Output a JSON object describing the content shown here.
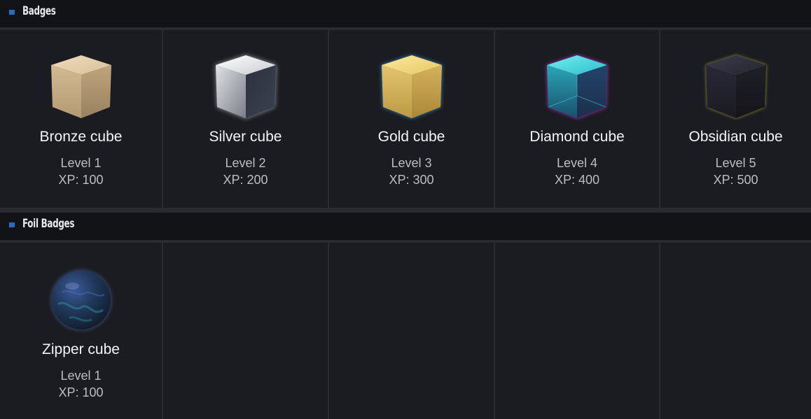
{
  "sections": [
    {
      "title": "Badges",
      "badges": [
        {
          "name": "Bronze cube",
          "level": "Level 1",
          "xp": "XP: 100",
          "icon": "bronze-cube-icon"
        },
        {
          "name": "Silver cube",
          "level": "Level 2",
          "xp": "XP: 200",
          "icon": "silver-cube-icon"
        },
        {
          "name": "Gold cube",
          "level": "Level 3",
          "xp": "XP: 300",
          "icon": "gold-cube-icon"
        },
        {
          "name": "Diamond cube",
          "level": "Level 4",
          "xp": "XP: 400",
          "icon": "diamond-cube-icon"
        },
        {
          "name": "Obsidian cube",
          "level": "Level 5",
          "xp": "XP: 500",
          "icon": "obsidian-cube-icon"
        }
      ]
    },
    {
      "title": "Foil Badges",
      "badges": [
        {
          "name": "Zipper cube",
          "level": "Level 1",
          "xp": "XP: 100",
          "icon": "zipper-sphere-icon"
        }
      ]
    }
  ],
  "colors": {
    "accent": "#1f6fc6",
    "header_bg": "#121317",
    "cell_bg": "#1b1c21",
    "divider": "#2a2b30",
    "bronze": "#c9b18a",
    "silver": "#b9bcc2",
    "gold": "#e4c46a",
    "diamond": "#3fd0d8",
    "diamond_glow": "#c23bd6",
    "obsidian": "#2a2a38",
    "obsidian_glow": "#b8b23a",
    "gold_glow": "#3aa0d6"
  }
}
